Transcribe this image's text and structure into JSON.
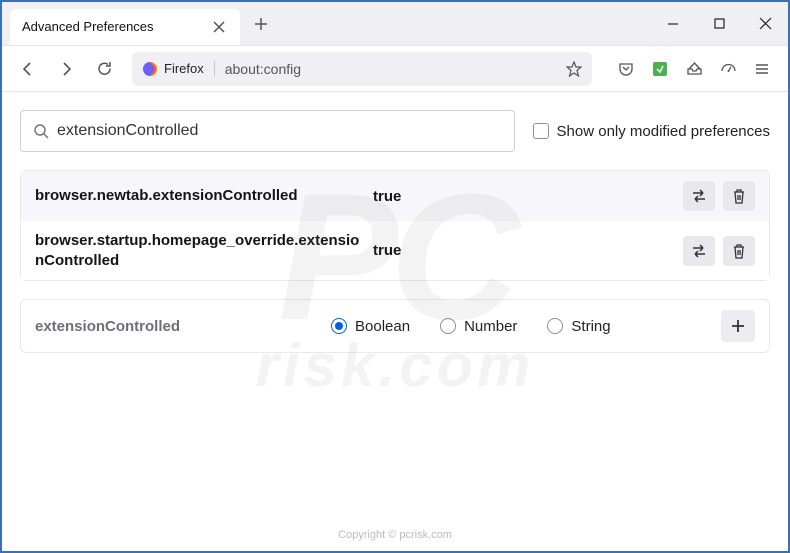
{
  "tab": {
    "title": "Advanced Preferences"
  },
  "urlbar": {
    "identity_label": "Firefox",
    "url": "about:config"
  },
  "search": {
    "value": "extensionControlled",
    "modified_label": "Show only modified preferences"
  },
  "prefs": [
    {
      "name": "browser.newtab.extensionControlled",
      "value": "true"
    },
    {
      "name": "browser.startup.homepage_override.extensionControlled",
      "value": "true"
    }
  ],
  "new_pref": {
    "name": "extensionControlled",
    "types": [
      "Boolean",
      "Number",
      "String"
    ],
    "selected": "Boolean"
  },
  "watermark": {
    "top": "PC",
    "bottom": "risk.com",
    "copyright": "Copyright © pcrisk.com"
  }
}
